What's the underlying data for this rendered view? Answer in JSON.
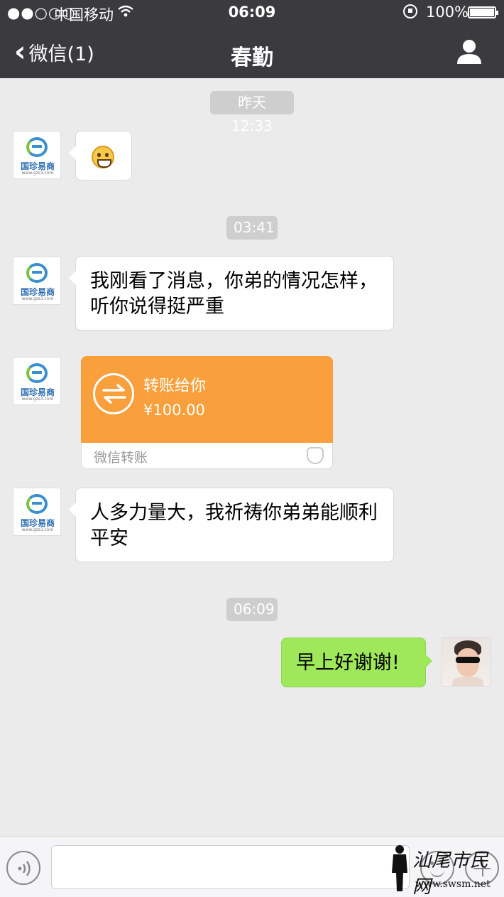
{
  "status_bar": {
    "signal": "●●○○○",
    "carrier": "中国移动",
    "time": "06:09",
    "battery": "100%"
  },
  "nav": {
    "back_label": "微信(1)",
    "title": "春勤"
  },
  "chat": {
    "timestamps": [
      "昨天 12:33",
      "03:41",
      "06:09"
    ],
    "avatar_brand": "国珍易商",
    "avatar_sub": "www.gzs3.com",
    "messages": [
      {
        "side": "left",
        "type": "emoji",
        "icon": "grin-emoji"
      },
      {
        "side": "left",
        "type": "text",
        "lines": [
          "我刚看了消息，你弟的情况怎样，",
          "听你说得挺严重"
        ]
      },
      {
        "side": "left",
        "type": "transfer",
        "title": "转账给你",
        "amount": "¥100.00",
        "footer": "微信转账"
      },
      {
        "side": "left",
        "type": "text",
        "lines": [
          "人多力量大，我祈祷你弟弟能顺利",
          "平安"
        ]
      },
      {
        "side": "right",
        "type": "text",
        "lines": [
          "早上好谢谢!"
        ]
      }
    ]
  },
  "input_bar": {
    "value": "",
    "placeholder": ""
  },
  "watermark": {
    "name": "汕尾市民网",
    "url": "www.swsm.net"
  },
  "colors": {
    "header_bg": "#3a3a3f",
    "chat_bg": "#ebebeb",
    "sent_bubble": "#9fe85a",
    "transfer_orange": "#f9a03c"
  }
}
